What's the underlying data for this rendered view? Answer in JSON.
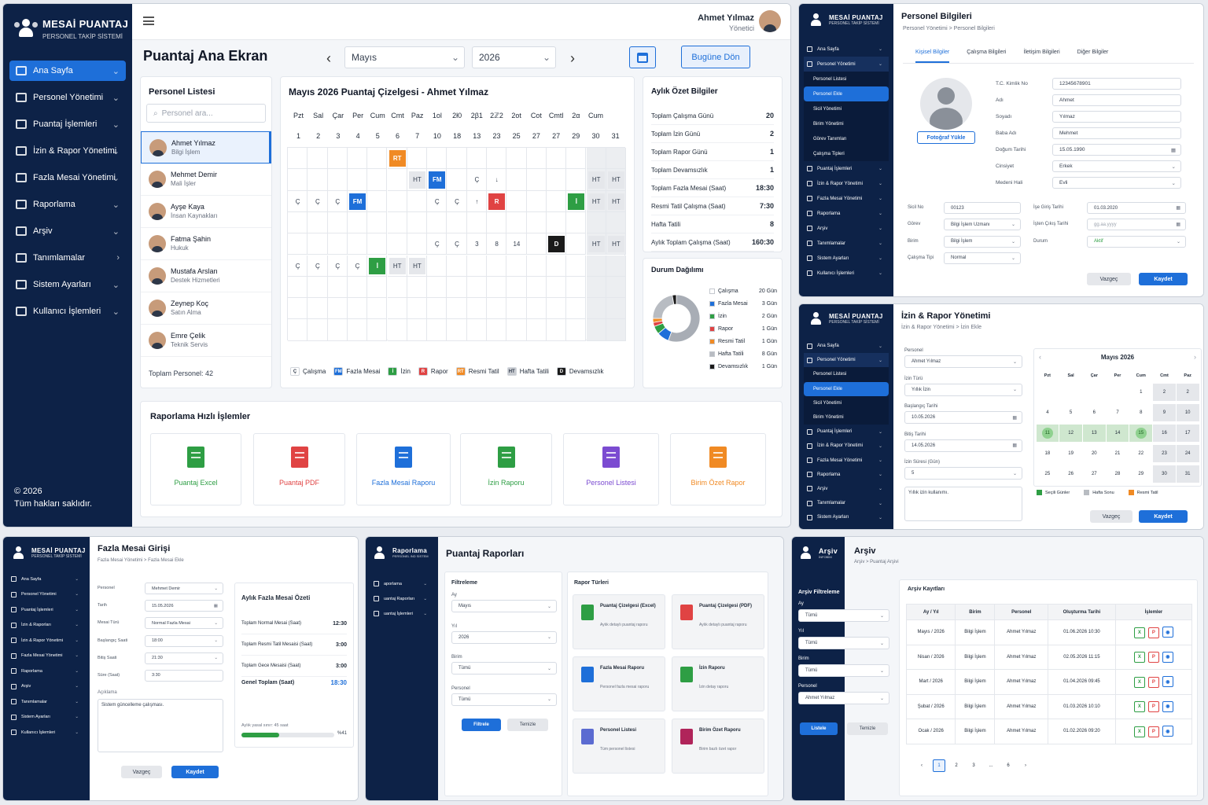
{
  "main": {
    "brand_title": "MESAİ PUANTAJ",
    "brand_sub": "PERSONEL TAKİP SİSTEMİ",
    "nav": [
      {
        "label": "Ana Sayfa",
        "icon": "home-icon"
      },
      {
        "label": "Personel Yönetimi",
        "icon": "users-icon"
      },
      {
        "label": "Puantaj İşlemleri",
        "icon": "calendar-icon"
      },
      {
        "label": "İzin & Rapor Yönetimi",
        "icon": "document-icon"
      },
      {
        "label": "Fazla Mesai Yönetimi",
        "icon": "clock-icon"
      },
      {
        "label": "Raporlama",
        "icon": "report-icon"
      },
      {
        "label": "Arşiv",
        "icon": "archive-icon"
      },
      {
        "label": "Tanımlamalar",
        "icon": "settings-icon"
      },
      {
        "label": "Sistem Ayarları",
        "icon": "gear-icon"
      },
      {
        "label": "Kullanıcı İşlemleri",
        "icon": "user-icon"
      }
    ],
    "footer_year": "© 2026",
    "footer_rights": "Tüm hakları saklıdır.",
    "user_name": "Ahmet Yılmaz",
    "user_role": "Yönetici",
    "page_title": "Puantaj Ana Ekran",
    "month": "Mayıs",
    "year": "2026",
    "today_btn": "Bugüne Dön",
    "personnel_title": "Personel Listesi",
    "search_placeholder": "Personel ara...",
    "personnel": [
      {
        "name": "Ahmet Yılmaz",
        "dept": "Bilgi İşlem"
      },
      {
        "name": "Mehmet Demir",
        "dept": "Mali İşler"
      },
      {
        "name": "Ayşe Kaya",
        "dept": "İnsan Kaynakları"
      },
      {
        "name": "Fatma Şahin",
        "dept": "Hukuk"
      },
      {
        "name": "Mustafa Arslan",
        "dept": "Destek Hizmetleri"
      },
      {
        "name": "Zeynep Koç",
        "dept": "Satın Alma"
      },
      {
        "name": "Emre Çelik",
        "dept": "Teknik Servis"
      }
    ],
    "total_personnel": "Toplam Personel: 42",
    "grid_title": "Mayıs 2026 Puantaj Çizelgesi - Ahmet Yılmaz",
    "day_names": [
      "Pzt",
      "Sal",
      "Çar",
      "Per",
      "Cum",
      "Cmt",
      "Paz",
      "1ol",
      "2ł0",
      "2β1",
      "2ℤ2",
      "2ot",
      "Cot",
      "Cmtl",
      "2α",
      "Cum"
    ],
    "day_nums": [
      "1",
      "2",
      "3",
      "4",
      "5",
      "6",
      "7",
      "10",
      "18",
      "13",
      "23",
      "25",
      "27",
      "27",
      "29",
      "30",
      "31"
    ],
    "legend": [
      {
        "code": "Ç",
        "label": "Çalışma",
        "color": "#ffffff"
      },
      {
        "code": "FM",
        "label": "Fazla Mesai",
        "color": "#1e6fd9"
      },
      {
        "code": "İ",
        "label": "İzin",
        "color": "#2e9e44"
      },
      {
        "code": "R",
        "label": "Rapor",
        "color": "#e04343"
      },
      {
        "code": "RT",
        "label": "Resmi Tatil",
        "color": "#f08a24"
      },
      {
        "code": "HT",
        "label": "Hafta Tatili",
        "color": "#c9ccd1"
      },
      {
        "code": "D",
        "label": "Devamsızlık",
        "color": "#1a1a1a"
      }
    ],
    "summary_title": "Aylık Özet Bilgiler",
    "summary": [
      {
        "k": "Toplam Çalışma Günü",
        "v": "20"
      },
      {
        "k": "Toplam İzin Günü",
        "v": "2"
      },
      {
        "k": "Toplam Rapor Günü",
        "v": "1"
      },
      {
        "k": "Toplam Devamsızlık",
        "v": "1"
      },
      {
        "k": "Toplam Fazla Mesai (Saat)",
        "v": "18:30"
      },
      {
        "k": "Resmi Tatil Çalışma (Saat)",
        "v": "7:30"
      },
      {
        "k": "Hafta Tatili",
        "v": "8"
      },
      {
        "k": "Aylık Toplam Çalışma (Saat)",
        "v": "160:30"
      }
    ],
    "dist_title": "Durum Dağılımı",
    "dist": [
      {
        "label": "Çalışma",
        "value": "20 Gün",
        "n": 20,
        "color": "#ffffff"
      },
      {
        "label": "Fazla Mesai",
        "value": "3 Gün",
        "n": 3,
        "color": "#1e6fd9"
      },
      {
        "label": "İzin",
        "value": "2 Gün",
        "n": 2,
        "color": "#2e9e44"
      },
      {
        "label": "Rapor",
        "value": "1 Gün",
        "n": 1,
        "color": "#e04343"
      },
      {
        "label": "Resmi Tatil",
        "value": "1 Gün",
        "n": 1,
        "color": "#f08a24"
      },
      {
        "label": "Hafta Tatili",
        "value": "8 Gün",
        "n": 8,
        "color": "#b8bcc2"
      },
      {
        "label": "Devamsızlık",
        "value": "1 Gün",
        "n": 1,
        "color": "#1a1a1a"
      }
    ],
    "quick_title": "Raporlama Hızlı İşlemler",
    "quick": [
      {
        "label": "Puantaj Excel",
        "color": "#2e9e44"
      },
      {
        "label": "Puantaj PDF",
        "color": "#e04343"
      },
      {
        "label": "Fazla Mesai Raporu",
        "color": "#1e6fd9"
      },
      {
        "label": "İzin Raporu",
        "color": "#2e9e44"
      },
      {
        "label": "Personel Listesi",
        "color": "#7b4bd1"
      },
      {
        "label": "Birim Özet Rapor",
        "color": "#f08a24"
      }
    ]
  },
  "p2": {
    "title": "Personel Bilgileri",
    "crumb": "Personel Yönetimi  >  Personel Bilgileri",
    "tabs": [
      "Kişisel Bilgiler",
      "Çalışma Bilgileri",
      "İletişim Bilgileri",
      "Diğer Bilgiler"
    ],
    "nav": [
      "Ana Sayfa",
      "Personel Yönetimi",
      "Personel Listesi",
      "Personel Ekle",
      "Sicil Yönetimi",
      "Birim Yönetimi",
      "Görev Tanımları",
      "Çalışma Tipleri",
      "Puantaj İşlemleri",
      "İzin & Rapor Yönetimi",
      "Fazla Mesai Yönetimi",
      "Raporlama",
      "Arşiv",
      "Tanımlamalar",
      "Sistem Ayarları",
      "Kullanıcı İşlemleri"
    ],
    "photo_btn": "Fotoğraf Yükle",
    "fields": [
      {
        "k": "T.C. Kimlik No",
        "v": "12345678901"
      },
      {
        "k": "Adı",
        "v": "Ahmet"
      },
      {
        "k": "Soyadı",
        "v": "Yılmaz"
      },
      {
        "k": "Baba Adı",
        "v": "Mehmet"
      },
      {
        "k": "Doğum Tarihi",
        "v": "15.05.1990"
      },
      {
        "k": "Cinsiyet",
        "v": "Erkek"
      },
      {
        "k": "Medeni Hali",
        "v": "Evli"
      }
    ],
    "left": [
      {
        "k": "Sicil No",
        "v": "00123"
      },
      {
        "k": "Görev",
        "v": "Bilgi İşlem Uzmanı"
      },
      {
        "k": "Birim",
        "v": "Bilgi İşlem"
      },
      {
        "k": "Çalışma Tipi",
        "v": "Normal"
      }
    ],
    "right": [
      {
        "k": "İşe Giriş Tarihi",
        "v": "01.03.2020"
      },
      {
        "k": "İşten Çıkış Tarihi",
        "v": "gg.aa.yyyy"
      },
      {
        "k": "Durum",
        "v": "Aktif"
      }
    ],
    "cancel": "Vazgeç",
    "save": "Kaydet"
  },
  "p3": {
    "title": "İzin & Rapor Yönetimi",
    "crumb": "İzin & Rapor Yönetimi  >  İzin Ekle",
    "nav": [
      "Ana Sayfa",
      "Personel Yönetimi",
      "Personel Listesi",
      "Personel Ekle",
      "Sicil Yönetimi",
      "Birim Yönetimi",
      "Puantaj İşlemleri",
      "İzin & Rapor Yönetimi",
      "Fazla Mesai Yönetimi",
      "Raporlama",
      "Arşiv",
      "Tanımlamalar",
      "Sistem Ayarları",
      "Kullanıcı İşlemleri"
    ],
    "fields": [
      {
        "k": "Personel",
        "v": "Ahmet Yılmaz"
      },
      {
        "k": "İzin Türü",
        "v": "Yıllık İzin"
      },
      {
        "k": "Başlangıç Tarihi",
        "v": "10.05.2026"
      },
      {
        "k": "Bitiş Tarihi",
        "v": "14.05.2026"
      },
      {
        "k": "İzin Süresi (Gün)",
        "v": "5"
      }
    ],
    "note": "Yıllık izin kullanımı.",
    "cal_title": "Mayıs 2026",
    "cal_days": [
      "Pzt",
      "Sal",
      "Çar",
      "Per",
      "Cum",
      "Cmt",
      "Paz"
    ],
    "cal_rows": [
      [
        "",
        "",
        "",
        "",
        "1",
        "2",
        "2"
      ],
      [
        "4",
        "5",
        "6",
        "7",
        "8",
        "9",
        "10"
      ],
      [
        "11",
        "12",
        "13",
        "14",
        "15",
        "16",
        "17"
      ],
      [
        "18",
        "19",
        "20",
        "21",
        "22",
        "23",
        "24"
      ],
      [
        "25",
        "26",
        "27",
        "28",
        "29",
        "30",
        "31"
      ]
    ],
    "cal_legend": [
      "Seçili Günler",
      "Hafta Sonu",
      "Resmi Tatil"
    ],
    "cancel": "Vazgeç",
    "save": "Kaydet"
  },
  "p4": {
    "title": "Fazla Mesai Girişi",
    "crumb": "Fazla Mesai Yönetimi  >  Fazla Mesai Ekle",
    "nav": [
      "Ana Sayfa",
      "Personel Yönetimi",
      "Puantaj İşlemleri",
      "İzin & Raporları",
      "İzin & Rapor Yönetimi",
      "Fazla Mesai Yönetimi",
      "Raporlama",
      "Arşiv",
      "Tanımlamalar",
      "Sistem Ayarları",
      "Kullanıcı İşlemleri"
    ],
    "fields": [
      {
        "k": "Personel",
        "v": "Mehmet Demir"
      },
      {
        "k": "Tarih",
        "v": "15.05.2026"
      },
      {
        "k": "Mesai Türü",
        "v": "Normal Fazla Mesai"
      },
      {
        "k": "Başlangıç Saati",
        "v": "18:00"
      },
      {
        "k": "Bitiş Saati",
        "v": "21:30"
      },
      {
        "k": "Süre (Saat)",
        "v": "3:30"
      }
    ],
    "note_label": "Açıklama",
    "note": "Sistem güncelleme çalışması.",
    "sum_title": "Aylık Fazla Mesai Özeti",
    "sum": [
      {
        "k": "Toplam Normal Mesai (Saat)",
        "v": "12:30"
      },
      {
        "k": "Toplam Resmi Tatil Mesaisi (Saat)",
        "v": "3:00"
      },
      {
        "k": "Toplam Gece Mesaisi (Saat)",
        "v": "3:00"
      }
    ],
    "total_k": "Genel Toplam (Saat)",
    "total_v": "18:30",
    "limit": "Aylık yasal sınır: 45 saat",
    "pct": "%41",
    "pct_n": 0.41,
    "cancel": "Vazgeç",
    "save": "Kaydet"
  },
  "p5": {
    "brand": "Raporlama",
    "brand_sub": "PERSONEL IND SİSTEM",
    "title": "Puantaj Raporları",
    "nav": [
      "aporlama",
      "uantaj Raporları",
      "uantaj İşlemleri"
    ],
    "filter_title": "Filtreleme",
    "filters": [
      {
        "k": "Ay",
        "v": "Mayıs"
      },
      {
        "k": "Yıl",
        "v": "2026"
      },
      {
        "k": "Birim",
        "v": "Tümü"
      },
      {
        "k": "Personel",
        "v": "Tümü"
      }
    ],
    "filter_btn": "Filtrele",
    "clear_btn": "Temizle",
    "types_title": "Rapor Türleri",
    "types": [
      {
        "t": "Puantaj Çizelgesi (Excel)",
        "d": "Aylık detaylı puantaj raporu",
        "color": "#2e9e44"
      },
      {
        "t": "Puantaj Çizelgesi (PDF)",
        "d": "Aylık detaylı puantaj raporu",
        "color": "#e04343"
      },
      {
        "t": "Fazla Mesai Raporu",
        "d": "Personel fazla mesai raporu",
        "color": "#1e6fd9"
      },
      {
        "t": "İzin Raporu",
        "d": "İzin detay raporu",
        "color": "#2e9e44"
      },
      {
        "t": "Personel Listesi",
        "d": "Tüm personel listesi",
        "color": "#5b6bd1"
      },
      {
        "t": "Birim Özet Raporu",
        "d": "Birim bazlı özet rapor",
        "color": "#b0245a"
      }
    ]
  },
  "p6": {
    "brand": "Arşiv",
    "brand_sub": "İNFOBİM",
    "title": "Arşiv",
    "crumb": "Arşiv  >  Puantaj Arşivi",
    "filter_title": "Arşiv Filtreleme",
    "filters": [
      {
        "k": "Ay",
        "v": "Tümü"
      },
      {
        "k": "Yıl",
        "v": "Tümü"
      },
      {
        "k": "Birim",
        "v": "Tümü"
      },
      {
        "k": "Personel",
        "v": "Ahmet Yılmaz"
      }
    ],
    "list_btn": "Listele",
    "clear_btn": "Temizle",
    "records_title": "Arşiv Kayıtları",
    "cols": [
      "Ay / Yıl",
      "Birim",
      "Personel",
      "Oluşturma Tarihi",
      "İşlemler"
    ],
    "rows": [
      [
        "Mayıs / 2026",
        "Bilgi İşlem",
        "Ahmet Yılmaz",
        "01.06.2026 10:30"
      ],
      [
        "Nisan / 2026",
        "Bilgi İşlem",
        "Ahmet Yılmaz",
        "02.05.2026 11:15"
      ],
      [
        "Mart / 2026",
        "Bilgi İşlem",
        "Ahmet Yılmaz",
        "01.04.2026 09:45"
      ],
      [
        "Şubat / 2026",
        "Bilgi İşlem",
        "Ahmet Yılmaz",
        "01.03.2026 10:10"
      ],
      [
        "Ocak / 2026",
        "Bilgi İşlem",
        "Ahmet Yılmaz",
        "01.02.2026 09:20"
      ]
    ],
    "pages": [
      "‹",
      "1",
      "2",
      "3",
      "...",
      "6",
      "›"
    ]
  }
}
